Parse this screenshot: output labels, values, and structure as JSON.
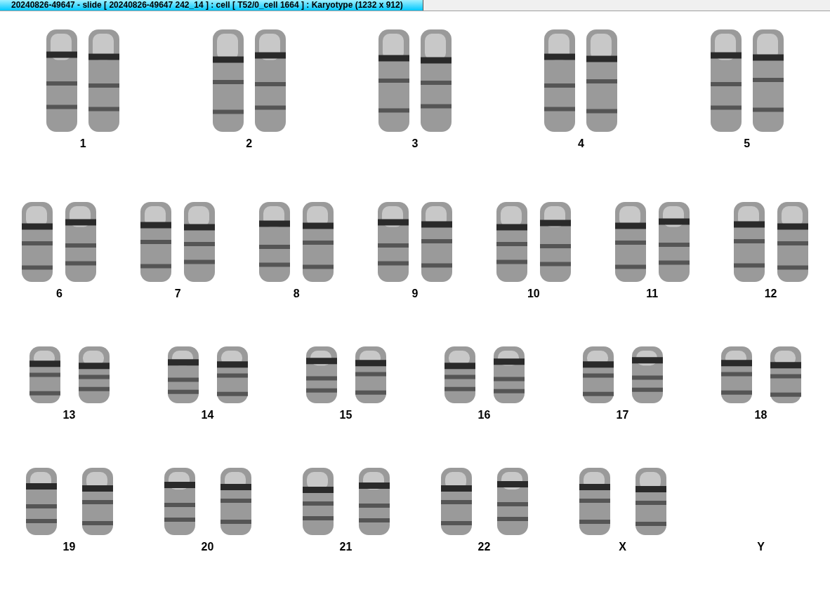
{
  "window": {
    "title": "20240826-49647 - slide [ 20240826-49647 242_14 ] : cell [ T52/0_cell 1664 ] : Karyotype  (1232 x 912)"
  },
  "karyotype": {
    "rows": [
      {
        "pairs": [
          {
            "label": "1",
            "kind": "pair"
          },
          {
            "label": "2",
            "kind": "pair"
          },
          {
            "label": "3",
            "kind": "pair"
          },
          {
            "label": "4",
            "kind": "pair"
          },
          {
            "label": "5",
            "kind": "pair"
          }
        ]
      },
      {
        "pairs": [
          {
            "label": "6",
            "kind": "pair"
          },
          {
            "label": "7",
            "kind": "pair"
          },
          {
            "label": "8",
            "kind": "pair"
          },
          {
            "label": "9",
            "kind": "pair"
          },
          {
            "label": "10",
            "kind": "pair"
          },
          {
            "label": "11",
            "kind": "pair"
          },
          {
            "label": "12",
            "kind": "pair"
          }
        ]
      },
      {
        "pairs": [
          {
            "label": "13",
            "kind": "pair"
          },
          {
            "label": "14",
            "kind": "pair"
          },
          {
            "label": "15",
            "kind": "pair"
          },
          {
            "label": "16",
            "kind": "pair"
          },
          {
            "label": "17",
            "kind": "pair"
          },
          {
            "label": "18",
            "kind": "pair"
          }
        ]
      },
      {
        "pairs": [
          {
            "label": "19",
            "kind": "pair"
          },
          {
            "label": "20",
            "kind": "pair"
          },
          {
            "label": "21",
            "kind": "pair"
          },
          {
            "label": "22",
            "kind": "pair"
          },
          {
            "label": "X",
            "kind": "pair"
          },
          {
            "label": "Y",
            "kind": "empty"
          }
        ]
      }
    ]
  }
}
